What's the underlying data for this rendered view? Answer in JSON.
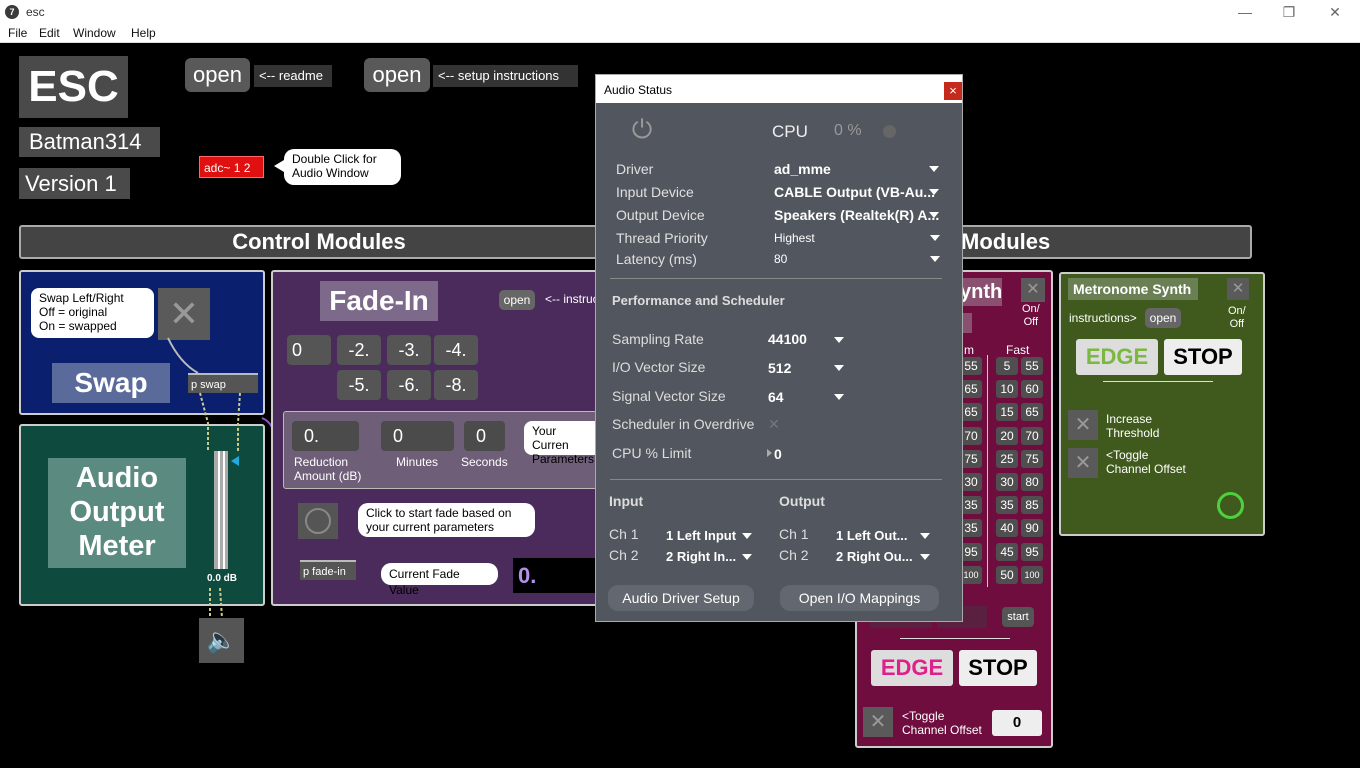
{
  "window": {
    "title": "esc",
    "app_icon": "7"
  },
  "menu": [
    "File",
    "Edit",
    "Window",
    "Help"
  ],
  "header": {
    "logo": "ESC",
    "author": "Batman314",
    "version": "Version 1",
    "open1": "open",
    "readme": "<-- readme",
    "open2": "open",
    "setup": "<--  setup instructions",
    "adc": "adc~ 1 2",
    "adc_note": "Double Click for\nAudio Window"
  },
  "sections": {
    "control": "Control Modules",
    "modules": "Modules"
  },
  "swap": {
    "note": "Swap Left/Right\nOff = original\nOn = swapped",
    "title": "Swap",
    "object": "p swap"
  },
  "meter": {
    "title": "Audio\nOutput\nMeter",
    "db": "0.0 dB"
  },
  "fadein": {
    "title": "Fade-In",
    "open": "open",
    "instr": "<-- instruc",
    "presets_row1": [
      "0",
      "-2.",
      "-3.",
      "-4."
    ],
    "presets_row2": [
      "-5.",
      "-6.",
      "-8."
    ],
    "reduction_value": "0.",
    "minutes_value": "0",
    "seconds_value": "0",
    "reduction_label": "Reduction\nAmount (dB)",
    "minutes_label": "Minutes",
    "seconds_label": "Seconds",
    "params_note": "Your Curren\nParameters",
    "start_note": "Click to start fade based on\nyour current parameters",
    "object": "p fade-in",
    "current_label": "Current Fade Value",
    "current_value": "0."
  },
  "synth": {
    "title_partial": "ynth",
    "onoff": "On/\nOff",
    "fast_label": "Fast",
    "m_label": "m",
    "left_col": [
      "55",
      "65",
      "65",
      "70",
      "75",
      "30",
      "35",
      "35",
      "95",
      "100"
    ],
    "fast_col1": [
      "5",
      "10",
      "15",
      "20",
      "25",
      "30",
      "35",
      "40",
      "45",
      "50"
    ],
    "fast_col2": [
      "55",
      "60",
      "65",
      "70",
      "75",
      "80",
      "85",
      "90",
      "95",
      "100"
    ],
    "start": "start",
    "edge": "EDGE",
    "stop": "STOP",
    "toggle_note": "<Toggle\nChannel Offset",
    "toggle_value": "0"
  },
  "metronome": {
    "title": "Metronome Synth",
    "instructions": "instructions>",
    "open": "open",
    "onoff": "On/\nOff",
    "edge": "EDGE",
    "stop": "STOP",
    "increase": "Increase\nThreshold",
    "toggle": "<Toggle\nChannel Offset"
  },
  "audio_status": {
    "title": "Audio Status",
    "close": "×",
    "cpu_label": "CPU",
    "cpu_value": "0 %",
    "driver_label": "Driver",
    "driver": "ad_mme",
    "input_label": "Input Device",
    "input": "CABLE Output (VB-Au...",
    "output_label": "Output Device",
    "output": "Speakers (Realtek(R) A...",
    "thread_label": "Thread Priority",
    "thread": "Highest",
    "latency_label": "Latency (ms)",
    "latency": "80",
    "perf_header": "Performance and Scheduler",
    "sr_label": "Sampling Rate",
    "sr": "44100",
    "io_label": "I/O Vector Size",
    "io": "512",
    "sv_label": "Signal Vector Size",
    "sv": "64",
    "overdrive_label": "Scheduler in Overdrive",
    "cpulimit_label": "CPU % Limit",
    "cpulimit": "0",
    "input_header": "Input",
    "output_header": "Output",
    "in_ch1_label": "Ch 1",
    "in_ch1": "1 Left Input",
    "in_ch2_label": "Ch 2",
    "in_ch2": "2 Right In...",
    "out_ch1_label": "Ch 1",
    "out_ch1": "1 Left Out...",
    "out_ch2_label": "Ch 2",
    "out_ch2": "2 Right Ou...",
    "setup_btn": "Audio Driver Setup",
    "mappings_btn": "Open I/O Mappings"
  },
  "colors": {
    "swap_bg": "#0a1f6e",
    "meter_bg": "#0f4a3e",
    "fade_bg": "#4a2b5c",
    "synth_bg": "#6e0d3e",
    "metronome_bg": "#3f5a1c",
    "adc_red": "#e01010"
  }
}
